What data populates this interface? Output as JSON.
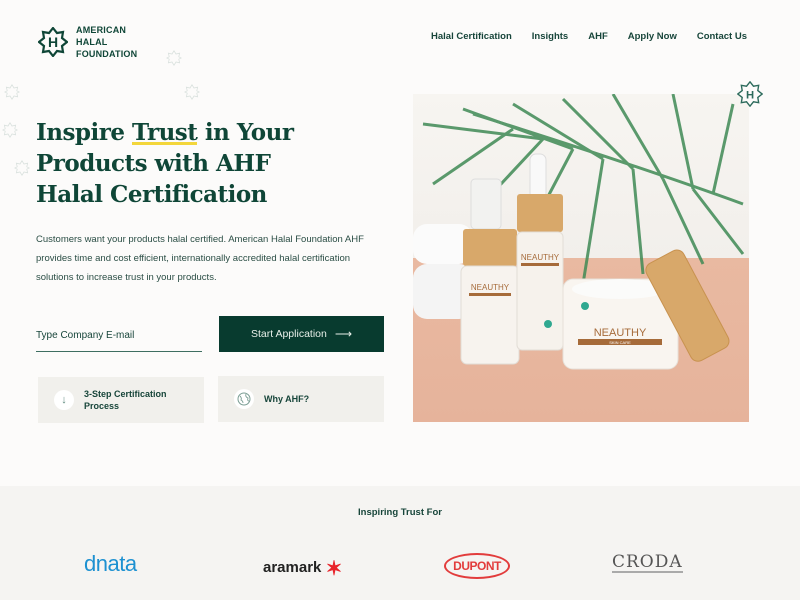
{
  "brand": {
    "name_line1": "AMERICAN HALAL",
    "name_line2": "FOUNDATION",
    "logo_letter": "H",
    "primary_color": "#0f4637",
    "button_color": "#083b2f",
    "highlight_color": "#f3d63b"
  },
  "nav": {
    "items": [
      {
        "label": "Halal Certification"
      },
      {
        "label": "Insights"
      },
      {
        "label": "AHF"
      },
      {
        "label": "Apply Now"
      },
      {
        "label": "Contact Us"
      }
    ]
  },
  "hero": {
    "title_pre": "Inspire ",
    "title_highlight": "Trust",
    "title_post": " in Your Products with AHF Halal Certification",
    "description": "Customers want your products halal certified. American Halal Foundation AHF provides time and cost efficient, internationally accredited halal certification solutions to increase trust in your products.",
    "email_placeholder": "Type Company E-mail",
    "cta_label": "Start Application",
    "cta_icon": "arrow-right-icon",
    "cards": [
      {
        "label": "3-Step Certification Process",
        "icon": "arrow-down-icon"
      },
      {
        "label": "Why AHF?",
        "icon": "globe-icon"
      }
    ],
    "image_alt": "NEAUTHY skin care products with palm leaf",
    "product_brand": "NEAUTHY",
    "product_sub": "SKIN CARE"
  },
  "trust": {
    "title": "Inspiring Trust For",
    "logos": [
      "dnata",
      "aramark",
      "DUPONT",
      "CRODA"
    ]
  }
}
